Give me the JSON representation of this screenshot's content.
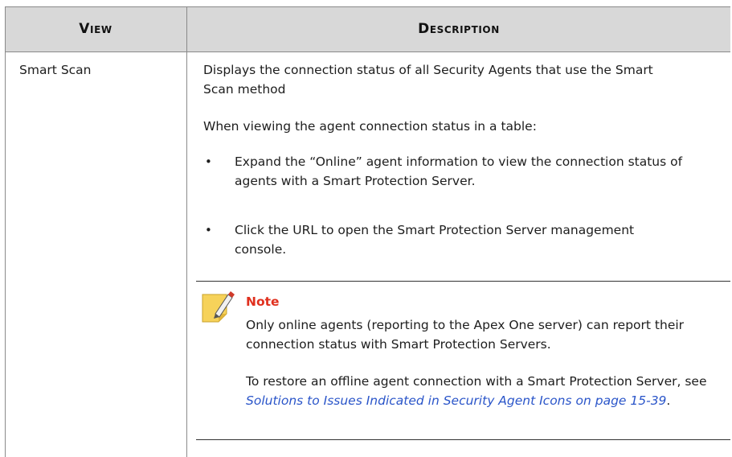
{
  "table": {
    "headers": {
      "view": "View",
      "description": "Description"
    },
    "row": {
      "view": "Smart Scan",
      "description_intro": "Displays the connection status of all Security Agents that use the Smart Scan method",
      "table_intro": "When viewing the agent connection status in a table:",
      "bullets": [
        "Expand the “Online” agent information to view the connection status of agents with a Smart Protection Server.",
        "Click the URL to open the Smart Protection Server management console."
      ],
      "note": {
        "title": "Note",
        "paragraph1": "Only online agents (reporting to the Apex One server) can report their connection status with Smart Protection Servers.",
        "paragraph2_prefix": "To restore an offline agent connection with a Smart Protection Server, see ",
        "link_text": "Solutions to Issues Indicated in Security Agent Icons on page 15-39",
        "paragraph2_suffix": "."
      }
    }
  },
  "colors": {
    "header_bg": "#d8d8d8",
    "note_title": "#e0301e",
    "link": "#2a55c9",
    "note_icon": "#f6d25a"
  },
  "icons": {
    "note": "note-pencil-icon"
  }
}
